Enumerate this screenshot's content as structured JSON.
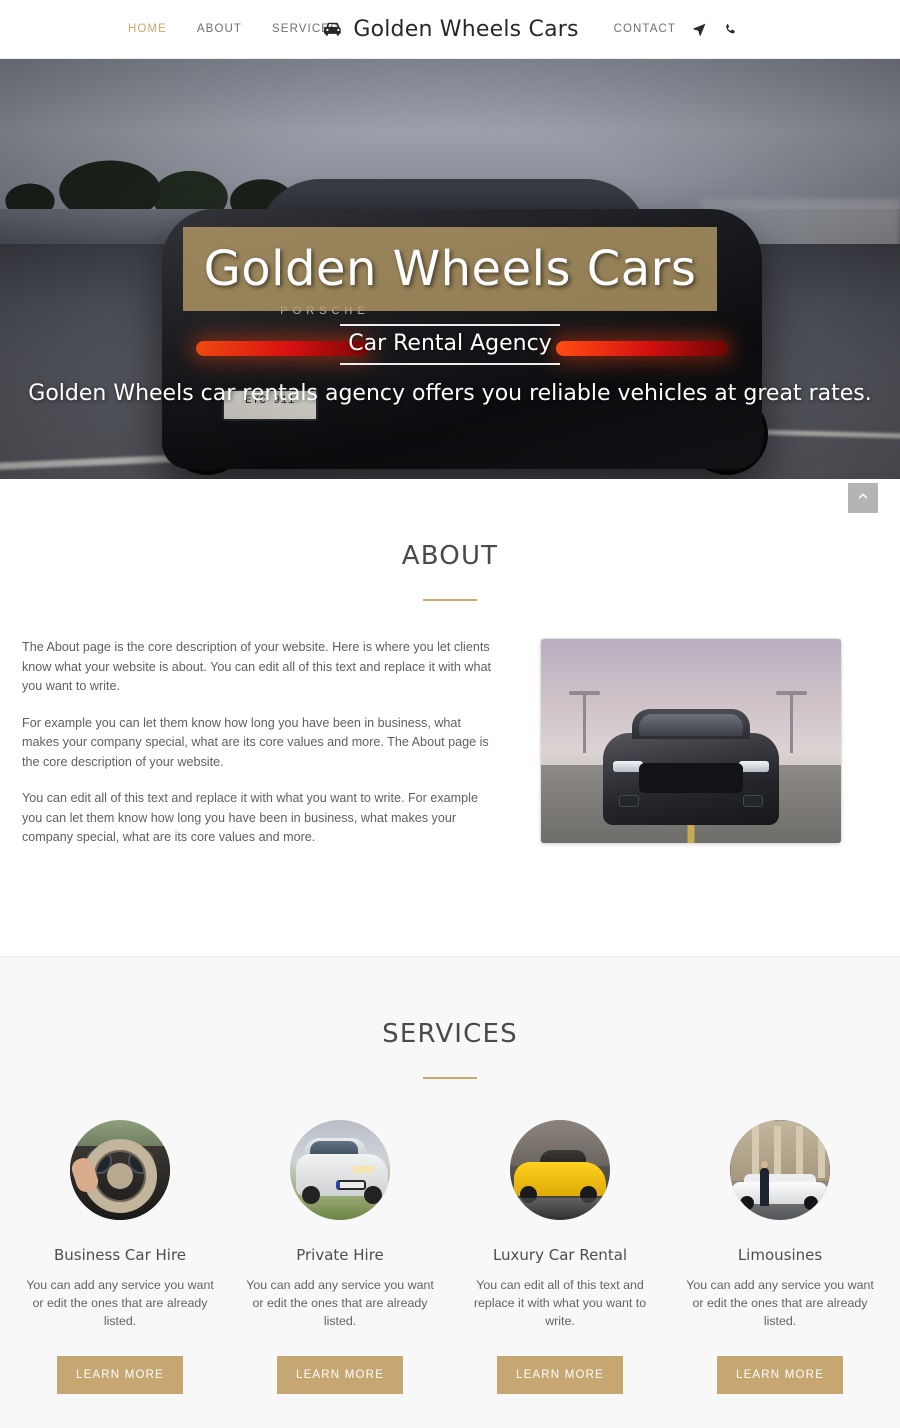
{
  "navbar": {
    "left_links": [
      {
        "label": "HOME",
        "active": true
      },
      {
        "label": "ABOUT",
        "active": false
      },
      {
        "label": "SERVICES",
        "active": false
      }
    ],
    "brand": {
      "icon": "car-icon",
      "text": "Golden Wheels Cars"
    },
    "right": {
      "contact_label": "CONTACT",
      "icons": [
        "navigation-arrow-icon",
        "phone-icon"
      ]
    },
    "accent_color": "#cda76a"
  },
  "hero": {
    "title": "Golden Wheels Cars",
    "subtitle": "Car Rental Agency",
    "description": "Golden Wheels car rentals agency offers you reliable vehicles at great rates.",
    "plate_text": "EYC 911",
    "car_badge": "PORSCHE",
    "band_color": "#b89e68"
  },
  "about": {
    "title": "ABOUT",
    "paragraphs": [
      "The About page is the core description of your website. Here is where you let clients know what your website is about. You can edit all of this text and replace it with what you want to write.",
      "For example you can let them know how long you have been in business, what makes your company special, what are its core values and more. The About page is the core description of your website.",
      "You can edit all of this text and replace it with what you want to write. For example you can let them know how long you have been in business, what makes your company special, what are its core values and more."
    ],
    "image_alt": "mustang-front-view-photo",
    "divider_color": "#cda76a"
  },
  "scroll_top": {
    "icon": "chevron-up-icon",
    "label": "Scroll to top"
  },
  "services": {
    "title": "SERVICES",
    "divider_color": "#cda76a",
    "button_color": "#c6a671",
    "items": [
      {
        "name": "Business Car Hire",
        "description": "You can add any service you want or edit the ones that are already listed.",
        "button": "LEARN MORE",
        "image_alt": "steering-wheel-photo"
      },
      {
        "name": "Private Hire",
        "description": "You can add any service you want or edit the ones that are already listed.",
        "button": "LEARN MORE",
        "image_alt": "white-hatchback-photo"
      },
      {
        "name": "Luxury Car Rental",
        "description": "You can edit all of this text and replace it with what you want to write.",
        "button": "LEARN MORE",
        "image_alt": "yellow-sports-car-photo"
      },
      {
        "name": "Limousines",
        "description": "You can add any service you want or edit the ones that are already listed.",
        "button": "LEARN MORE",
        "image_alt": "white-limousine-photo"
      }
    ]
  }
}
